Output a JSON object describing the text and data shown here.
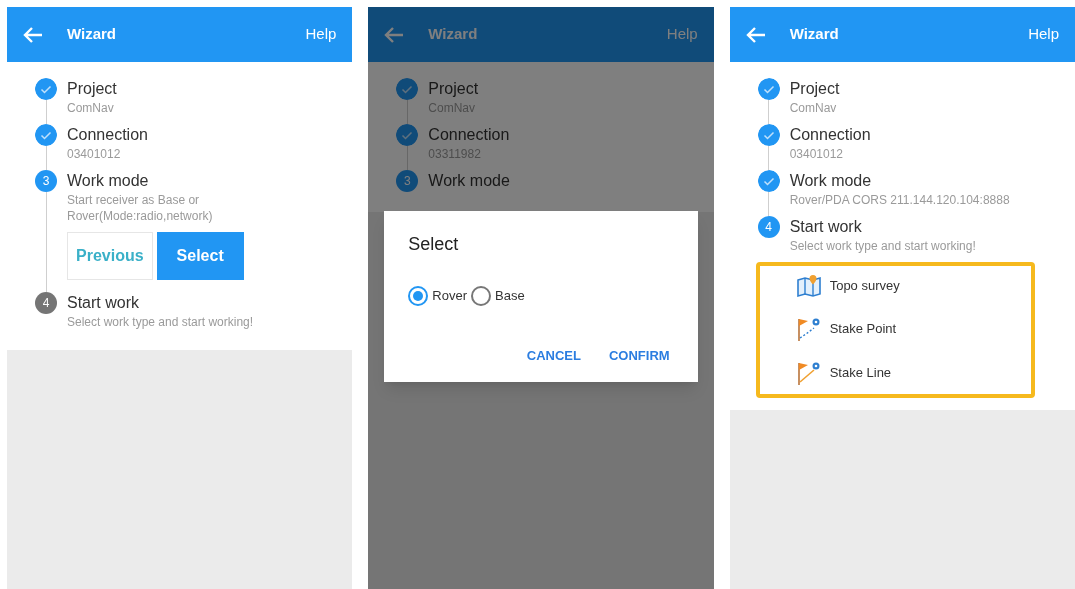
{
  "screens": [
    {
      "header": {
        "title": "Wizard",
        "help": "Help"
      },
      "steps": [
        {
          "title": "Project",
          "detail": "ComNav",
          "completed": true
        },
        {
          "title": "Connection",
          "detail": "03401012",
          "completed": true
        },
        {
          "number": "3",
          "title": "Work mode",
          "detail": "Start receiver as Base or Rover(Mode:radio,network)",
          "completed": false,
          "active": true,
          "actions": [
            {
              "label": "Previous",
              "primary": false
            },
            {
              "label": "Select",
              "primary": true
            }
          ]
        },
        {
          "number": "4",
          "title": "Start work",
          "detail": "Select work type and start working!",
          "completed": false,
          "active": false
        }
      ]
    },
    {
      "header": {
        "title": "Wizard",
        "help": "Help"
      },
      "steps": [
        {
          "title": "Project",
          "detail": "ComNav",
          "completed": true
        },
        {
          "title": "Connection",
          "detail": "03311982",
          "completed": true
        },
        {
          "number": "3",
          "title": "Work mode",
          "completed": false,
          "active": true
        }
      ],
      "dialog": {
        "title": "Select",
        "options": [
          {
            "label": "Rover",
            "selected": true
          },
          {
            "label": "Base",
            "selected": false
          }
        ],
        "buttons": [
          "CANCEL",
          "CONFIRM"
        ]
      }
    },
    {
      "header": {
        "title": "Wizard",
        "help": "Help"
      },
      "steps": [
        {
          "title": "Project",
          "detail": "ComNav",
          "completed": true
        },
        {
          "title": "Connection",
          "detail": "03401012",
          "completed": true
        },
        {
          "title": "Work mode",
          "detail": "Rover/PDA CORS 211.144.120.104:8888",
          "completed": true
        },
        {
          "number": "4",
          "title": "Start work",
          "detail": "Select work type and start working!",
          "completed": false,
          "active": true
        }
      ],
      "work_types": {
        "highlighted": true,
        "items": [
          {
            "label": "Topo survey",
            "kind": "map"
          },
          {
            "label": "Stake Point",
            "kind": "point"
          },
          {
            "label": "Stake Line",
            "kind": "line"
          }
        ]
      }
    }
  ]
}
